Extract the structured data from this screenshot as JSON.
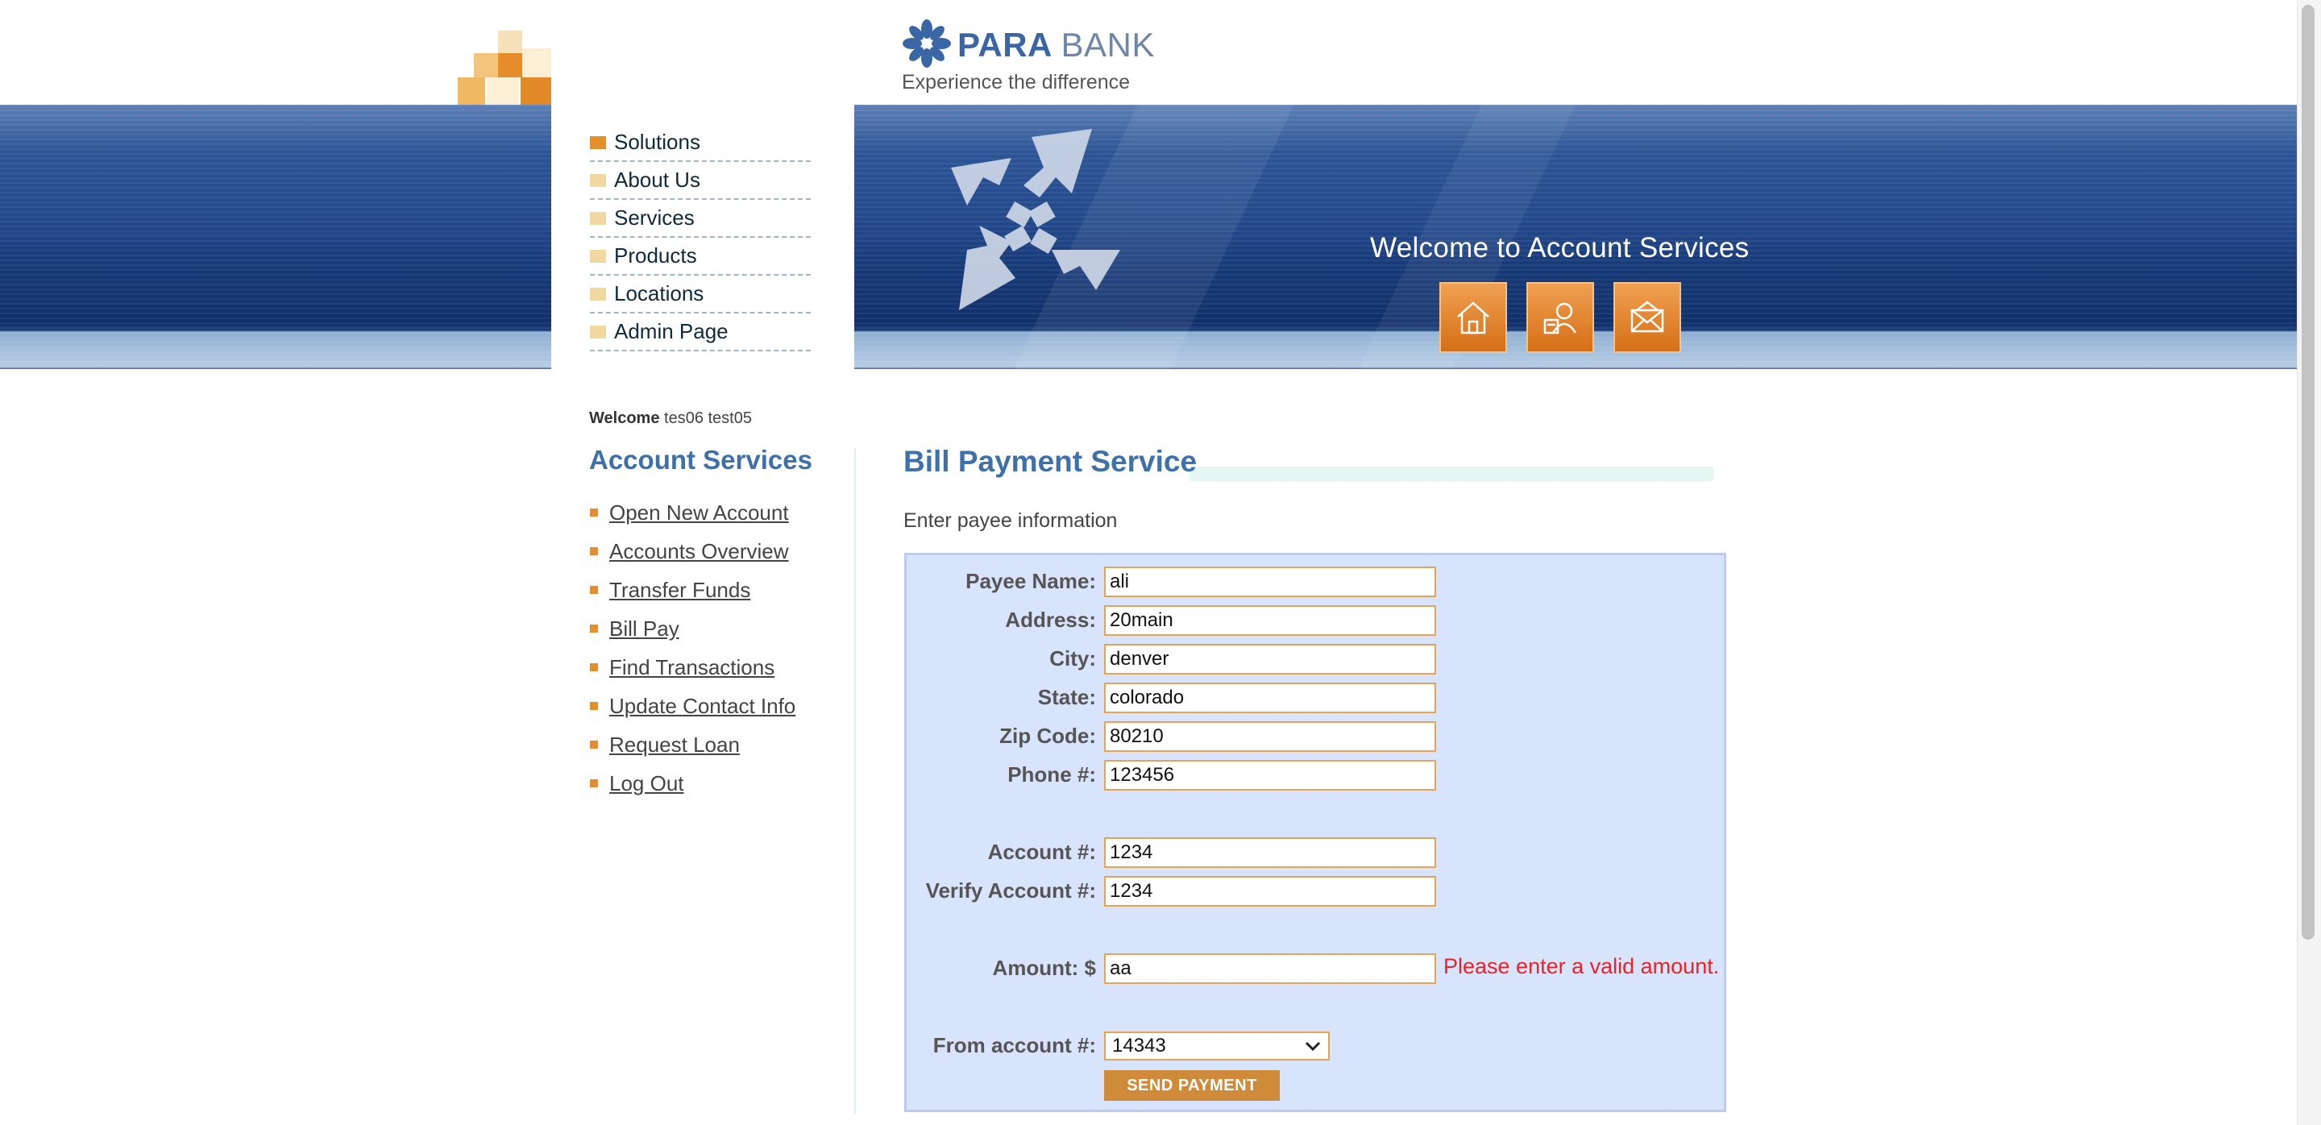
{
  "brand": {
    "logo_main": "PARA",
    "logo_second": "BANK",
    "tagline": "Experience the difference"
  },
  "top_nav": {
    "items": [
      {
        "label": "Solutions"
      },
      {
        "label": "About Us"
      },
      {
        "label": "Services"
      },
      {
        "label": "Products"
      },
      {
        "label": "Locations"
      },
      {
        "label": "Admin Page"
      }
    ]
  },
  "banner": {
    "welcome": "Welcome to Account Services",
    "icons": [
      "home-icon",
      "contact-icon",
      "mail-icon"
    ]
  },
  "user": {
    "welcome_label": "Welcome",
    "name": "tes06 test05"
  },
  "account_services": {
    "title": "Account Services",
    "links": [
      {
        "label": "Open New Account"
      },
      {
        "label": "Accounts Overview"
      },
      {
        "label": "Transfer Funds"
      },
      {
        "label": "Bill Pay"
      },
      {
        "label": "Find Transactions"
      },
      {
        "label": "Update Contact Info"
      },
      {
        "label": "Request Loan"
      },
      {
        "label": "Log Out"
      }
    ]
  },
  "bill_payment": {
    "title": "Bill Payment Service",
    "subtitle": "Enter payee information",
    "fields": {
      "payee_name": {
        "label": "Payee Name:",
        "value": "ali"
      },
      "address": {
        "label": "Address:",
        "value": "20main"
      },
      "city": {
        "label": "City:",
        "value": "denver"
      },
      "state": {
        "label": "State:",
        "value": "colorado"
      },
      "zip_code": {
        "label": "Zip Code:",
        "value": "80210"
      },
      "phone": {
        "label": "Phone #:",
        "value": "123456"
      },
      "account": {
        "label": "Account #:",
        "value": "1234"
      },
      "verify_account": {
        "label": "Verify Account #:",
        "value": "1234"
      },
      "amount": {
        "label": "Amount: $",
        "value": "aa"
      }
    },
    "amount_error": "Please enter a valid amount.",
    "from_account": {
      "label": "From account #:",
      "selected": "14343"
    },
    "send_button": "SEND PAYMENT"
  },
  "colors": {
    "brand_blue": "#3e70a9",
    "accent_orange": "#e58e2e",
    "form_background": "#d8e4fb",
    "error_red": "#e4242a",
    "button_orange": "#cf8a3a"
  }
}
